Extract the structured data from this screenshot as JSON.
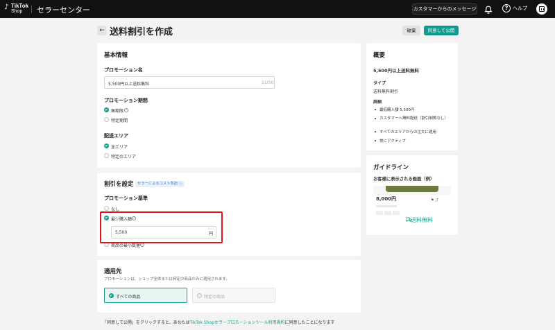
{
  "topbar": {
    "logo_line1": "TikTok",
    "logo_line2": "Shop",
    "brand": "セラーセンター",
    "messages_button": "カスタマーからのメッセージ",
    "help_label": "ヘルプ"
  },
  "header": {
    "back_glyph": "←",
    "title": "送料割引を作成",
    "draft_button": "破棄",
    "publish_button": "同意して公開"
  },
  "basic_info": {
    "heading": "基本情報",
    "promo_name_label": "プロモーション名",
    "promo_name_value": "5,500円以上送料無料",
    "promo_name_counter": "11/50",
    "period_label": "プロモーション期間",
    "period_options": [
      "無期限",
      "特定期間"
    ],
    "area_label": "配送エリア",
    "area_options": [
      "全エリア",
      "特定のエリア"
    ]
  },
  "discount": {
    "heading": "割引を設定",
    "tag": "セラーによるコスト負担",
    "criteria_label": "プロモーション基準",
    "options": [
      "なし",
      "最少購入額",
      "商品の最小数量"
    ],
    "amount_value": "5,500",
    "amount_unit": "円"
  },
  "scope": {
    "heading": "適用先",
    "description": "プロモーションは、ショップ全体または特定の商品のみに適用されます。",
    "options": [
      "すべての商品",
      "特定の商品"
    ]
  },
  "footer": {
    "pre": "「同意して公開」をクリックすると、あなたは",
    "link": "TikTok Shopセラープロモーションツール利用規約",
    "post": "に同意したことになります"
  },
  "summary": {
    "heading": "概要",
    "name": "5,500円以上送料無料",
    "type_label": "タイプ",
    "type_value": "送料無料割引",
    "details_label": "詳細",
    "details": [
      "最低購入額 5,500円",
      "カスタマーへ無料配送（割引制限なし）",
      "すべてのエリアからの注文に適用",
      "常にアクティブ"
    ]
  },
  "guide": {
    "heading": "ガイドライン",
    "subheading": "お客様に表示される画面（例）",
    "preview_price": "8,000円",
    "preview_free_shipping": "送料無料"
  },
  "colors": {
    "accent": "#129a8c",
    "highlight": "#e2141e",
    "topbar": "#121212"
  }
}
